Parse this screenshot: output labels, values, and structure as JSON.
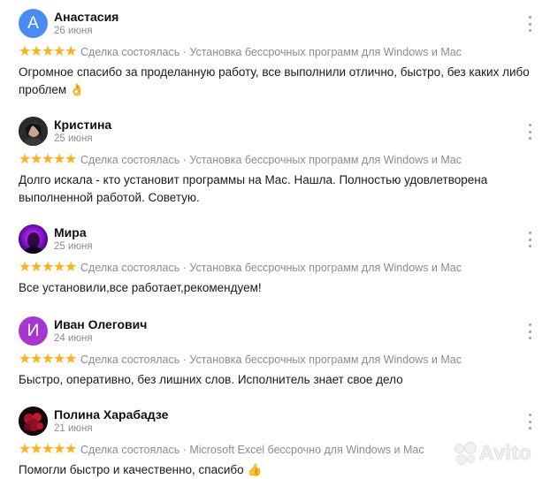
{
  "reviews": [
    {
      "name": "Анастасия",
      "date": "26 июня",
      "avatar_letter": "А",
      "avatar_color": "#4a8df2",
      "stars": 5,
      "deal": "Сделка состоялась · Установка бессрочных программ для Windows и Mac",
      "text": "Огромное спасибо за проделанную работу, все выполнили отлично, быстро, без каких либо проблем",
      "emoji": "👌"
    },
    {
      "name": "Кристина",
      "date": "25 июня",
      "avatar_letter": "",
      "avatar_color": "#1c1c1c",
      "stars": 5,
      "deal": "Сделка состоялась · Установка бессрочных программ для Windows и Mac",
      "text": "Долго искала - кто установит программы на Mac. Нашла. Полностью удовлетворена выполненной работой. Советую.",
      "emoji": ""
    },
    {
      "name": "Мира",
      "date": "25 июня",
      "avatar_letter": "",
      "avatar_color": "#7a1fd6",
      "stars": 5,
      "deal": "Сделка состоялась · Установка бессрочных программ для Windows и Mac",
      "text": "Все установили,все работает,рекомендуем!",
      "emoji": ""
    },
    {
      "name": "Иван Олегович",
      "date": "24 июня",
      "avatar_letter": "И",
      "avatar_color": "#a736d1",
      "stars": 5,
      "deal": "Сделка состоялась · Установка бессрочных программ для Windows и Mac",
      "text": "Быстро, оперативно, без лишних слов. Исполнитель знает свое дело",
      "emoji": ""
    },
    {
      "name": "Полина Харабадзе",
      "date": "21 июня",
      "avatar_letter": "",
      "avatar_color": "#2a1010",
      "stars": 5,
      "deal": "Сделка состоялась · Microsoft Excel бессрочно для Windows и Mac",
      "text": "Помогли быстро и качественно, спасибо",
      "emoji": "👍"
    }
  ],
  "icons": {
    "star": "star-icon",
    "menu": "more-vertical-icon"
  },
  "colors": {
    "star": "#ffb021",
    "muted_text": "#8c8c8c"
  },
  "watermark": "Avito"
}
